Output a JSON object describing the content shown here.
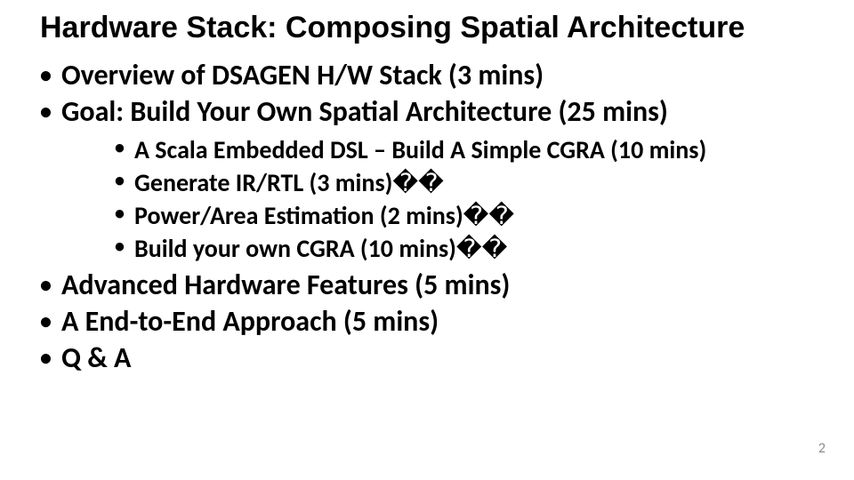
{
  "slide": {
    "title": "Hardware Stack: Composing Spatial Architecture",
    "page_number": "2",
    "bullets": {
      "b1": "Overview of DSAGEN H/W Stack (3 mins)",
      "b2": "Goal: Build Your Own Spatial Architecture (25 mins)",
      "b2_children": {
        "c1": "A Scala Embedded DSL – Build A Simple CGRA (10 mins)",
        "c2": "Generate IR/RTL (3 mins)",
        "c2_suffix": "��",
        "c3": "Power/Area Estimation (2 mins)",
        "c3_suffix": "��",
        "c4": "Build your own CGRA (10 mins)",
        "c4_suffix": "��"
      },
      "b3": "Advanced Hardware Features (5 mins)",
      "b4": "A End-to-End Approach (5 mins)",
      "b5": "Q & A"
    }
  }
}
